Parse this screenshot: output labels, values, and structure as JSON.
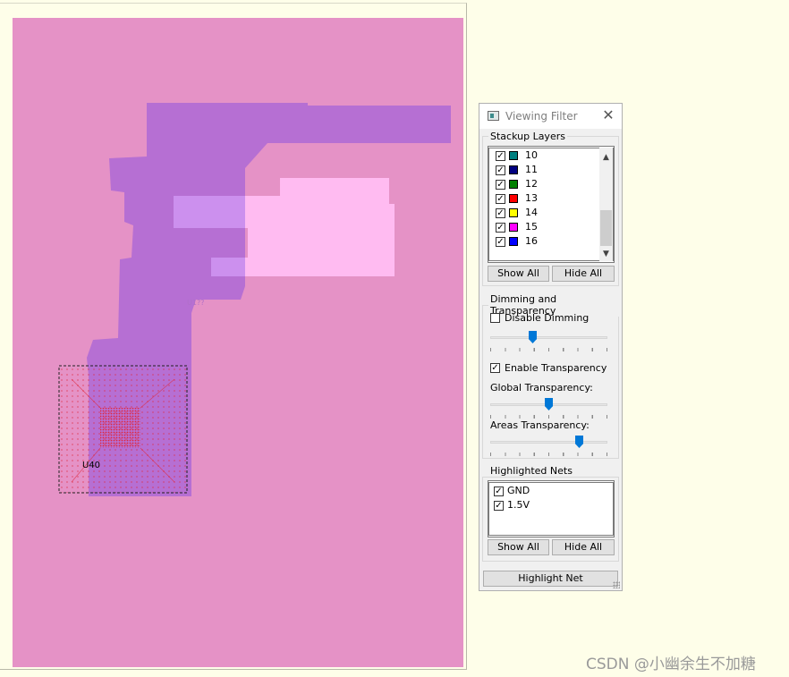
{
  "canvas": {
    "component_label": "U40",
    "small_label": "U1??",
    "colors": {
      "board": "#e592c6",
      "plane": "#b66fd3",
      "overlap_region": "#cc90ee",
      "highlight_region": "#ffbbf1",
      "via": "#e0283c"
    }
  },
  "panel": {
    "title": "Viewing Filter",
    "close_icon": "close-icon",
    "stackup_group_title": "Stackup Layers",
    "layers": [
      {
        "name": "10",
        "color": "#008080",
        "checked": true
      },
      {
        "name": "11",
        "color": "#000080",
        "checked": true
      },
      {
        "name": "12",
        "color": "#008000",
        "checked": true
      },
      {
        "name": "13",
        "color": "#ff0000",
        "checked": true
      },
      {
        "name": "14",
        "color": "#ffff00",
        "checked": true
      },
      {
        "name": "15",
        "color": "#ff00ff",
        "checked": true
      },
      {
        "name": "16",
        "color": "#0000ff",
        "checked": true
      }
    ],
    "stackup_show_all": "Show All",
    "stackup_hide_all": "Hide All",
    "dimming_group_title": "Dimming and Transparency",
    "disable_dimming_label": "Disable Dimming",
    "disable_dimming_checked": false,
    "dimming_level": 0.35,
    "enable_transparency_label": "Enable Transparency",
    "enable_transparency_checked": true,
    "global_transparency_label": "Global Transparency:",
    "global_transparency_level": 0.5,
    "areas_transparency_label": "Areas Transparency:",
    "areas_transparency_level": 0.78,
    "nets_group_title": "Highlighted Nets",
    "nets": [
      {
        "name": "GND",
        "checked": true
      },
      {
        "name": "1.5V",
        "checked": true
      }
    ],
    "nets_show_all": "Show All",
    "nets_hide_all": "Hide All",
    "highlight_net": "Highlight Net"
  },
  "watermark": "CSDN @小幽余生不加糖"
}
